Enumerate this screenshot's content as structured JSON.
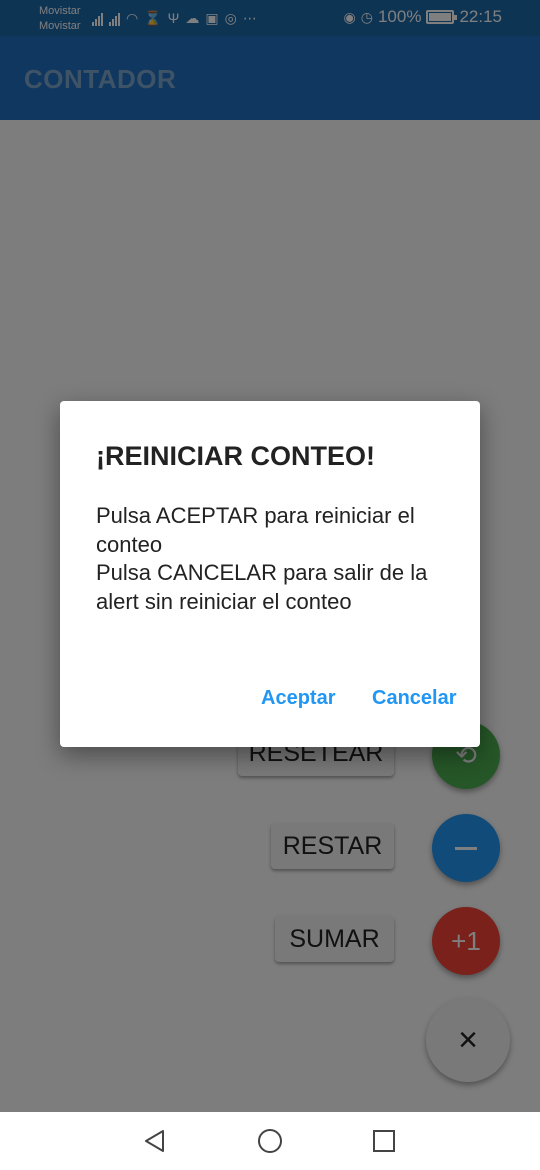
{
  "status_bar": {
    "carrier_1": "Movistar",
    "carrier_2": "Movistar",
    "battery_percent": "100%",
    "time": "22:15",
    "icons": [
      "signal-icon",
      "signal-icon",
      "wifi-icon",
      "hourglass-icon",
      "usb-icon",
      "cloud-icon",
      "gallery-icon",
      "instagram-icon",
      "more-icon",
      "eye-icon",
      "alarm-icon",
      "battery-icon"
    ]
  },
  "app_bar": {
    "title": "CONTADOR"
  },
  "actions": {
    "reset_label": "RESETEAR",
    "subtract_label": "RESTAR",
    "add_label": "SUMAR",
    "add_fab_text": "+1",
    "close_glyph": "×"
  },
  "dialog": {
    "title": "¡REINICIAR CONTEO!",
    "body": "Pulsa ACEPTAR para reiniciar el conteo\nPulsa CANCELAR para salir de la alert sin reiniciar el conteo",
    "accept_label": "Aceptar",
    "cancel_label": "Cancelar"
  },
  "colors": {
    "primary": "#1e6fbf",
    "reset_fab": "#4caf50",
    "subtract_fab": "#2196f3",
    "add_fab": "#f44336",
    "dialog_action": "#2196f3"
  }
}
